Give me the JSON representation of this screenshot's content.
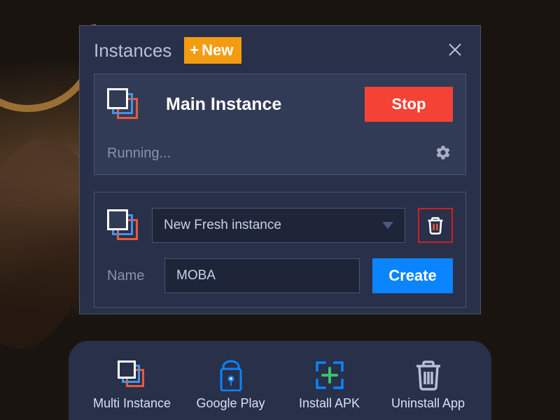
{
  "dialog": {
    "title": "Instances",
    "new_button": "New",
    "main_instance": {
      "name": "Main Instance",
      "stop_label": "Stop",
      "status": "Running..."
    },
    "new_instance": {
      "dropdown_value": "New Fresh instance",
      "name_label": "Name",
      "name_value": "MOBA",
      "create_label": "Create"
    }
  },
  "bottom_bar": {
    "multi_instance": "Multi Instance",
    "google_play": "Google Play",
    "install_apk": "Install APK",
    "uninstall_app": "Uninstall App"
  },
  "colors": {
    "accent_orange": "#f39c12",
    "accent_red": "#f44336",
    "accent_blue": "#0a84ff",
    "panel_bg": "#28304a"
  }
}
